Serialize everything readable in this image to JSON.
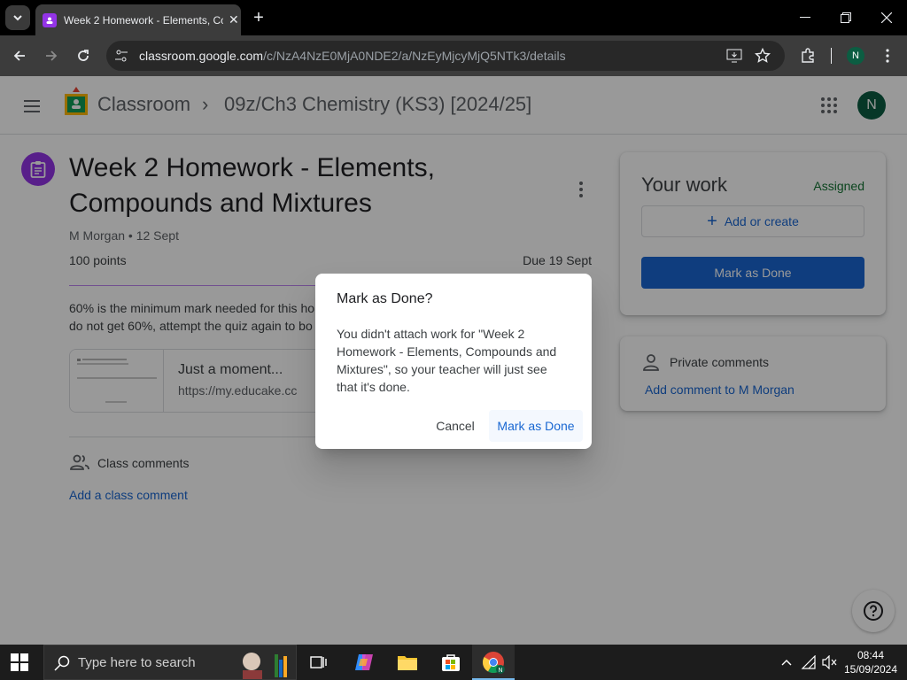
{
  "browser": {
    "tab_title": "Week 2 Homework - Elements, Compounds and Mixtures",
    "url_host": "classroom.google.com",
    "url_path": "/c/NzA4NzE0MjA0NDE2/a/NzEyMjcyMjQ5NTk3/details",
    "profile_initial": "N"
  },
  "app": {
    "brand": "Classroom",
    "class_name": "09z/Ch3 Chemistry (KS3) [2024/25]",
    "avatar_initial": "N"
  },
  "assignment": {
    "title": "Week 2 Homework - Elements, Compounds and Mixtures",
    "author_line": "M Morgan • 12 Sept",
    "points": "100 points",
    "due": "Due 19 Sept",
    "description_line1": "60% is the minimum mark needed for this ho",
    "description_line2": "do not get 60%, attempt the quiz again to bo",
    "attachment_title": "Just a moment...",
    "attachment_url": "https://my.educake.cc",
    "class_comments_label": "Class comments",
    "add_class_comment": "Add a class comment"
  },
  "your_work": {
    "title": "Your work",
    "status": "Assigned",
    "add_create": "Add or create",
    "mark_done": "Mark as Done"
  },
  "private_comments": {
    "label": "Private comments",
    "add": "Add comment to M Morgan"
  },
  "dialog": {
    "title": "Mark as Done?",
    "body": "You didn't attach work for \"Week 2 Homework - Elements, Compounds and Mixtures\", so your teacher will just see that it's done.",
    "cancel": "Cancel",
    "confirm": "Mark as Done"
  },
  "taskbar": {
    "search_placeholder": "Type here to search",
    "time": "08:44",
    "date": "15/09/2024"
  },
  "colors": {
    "accent_blue": "#1967d2",
    "assignment_purple": "#9334e6",
    "status_green": "#137333"
  }
}
